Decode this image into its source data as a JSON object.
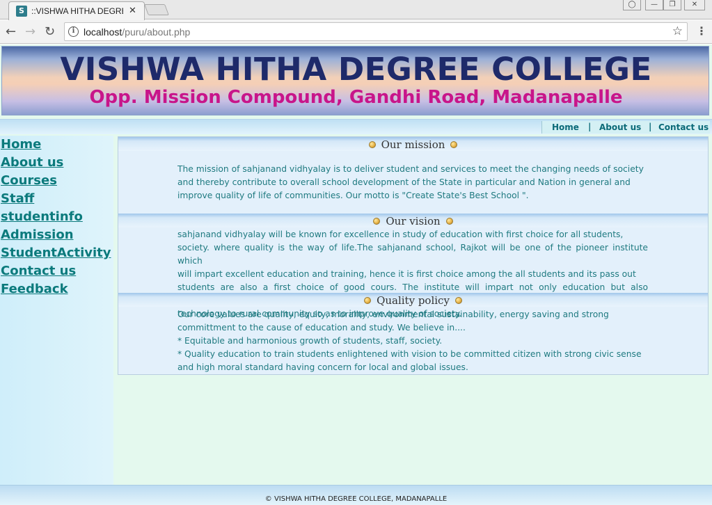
{
  "browser": {
    "tab_title": "::VISHWA HITHA DEGREE",
    "favicon_letter": "S",
    "close_glyph": "✕",
    "url_host": "localhost",
    "url_path": "/puru/about.php"
  },
  "banner": {
    "title": "VISHWA HITHA DEGREE COLLEGE",
    "subtitle": "Opp. Mission Compound, Gandhi Road, Madanapalle"
  },
  "topnav": {
    "items": [
      {
        "label": "Home"
      },
      {
        "label": "About us"
      },
      {
        "label": "Contact us"
      }
    ],
    "separator": "|"
  },
  "sidebar": {
    "items": [
      {
        "label": "Home"
      },
      {
        "label": "About us"
      },
      {
        "label": "Courses"
      },
      {
        "label": "Staff"
      },
      {
        "label": "studentinfo"
      },
      {
        "label": "Admission"
      },
      {
        "label": "StudentActivity"
      },
      {
        "label": "Contact us"
      },
      {
        "label": "Feedback"
      }
    ]
  },
  "sections": {
    "mission": {
      "title": "Our mission",
      "lines": [
        "The mission of sahjanand vidhyalay is to deliver student and services to meet the changing needs of society",
        "and thereby contribute to overall school development of the State in particular and Nation in general and",
        "improve quality of life of communities. Our motto is \"Create State's Best School \"."
      ]
    },
    "vision": {
      "title": "Our vision",
      "lines": [
        "sahjanand vidhyalay will be known for excellence in study of education with first choice for all students,",
        "society. where quality is the way of life.The sahjanand school, Rajkot will be one of the pioneer institute which",
        "will impart excellent education and training, hence it is first choice among the all students and its pass out",
        "students are also a first choice of good cours. The institute will impart not only education but also transferring",
        "technology to rural community so as to improve quality of society."
      ]
    },
    "quality": {
      "title": "Quality policy",
      "lines": [
        "Our core values are quality, equity, morality, environmental sustainability, energy saving and strong",
        "committment to the cause of education and study. We believe in....",
        "* Equitable and harmonious growth of students, staff, society.",
        "* Quality education to train students enlightened with vision to be committed citizen with strong civic sense",
        "and  high moral standard having concern for local and global issues."
      ]
    }
  },
  "footer": {
    "text": "© VISHWA HITHA DEGREE COLLEGE, MADANAPALLE"
  },
  "colors": {
    "link_teal": "#0b7a7c",
    "body_text": "#1f7a80",
    "page_bg": "#e4f9ee",
    "banner_title": "#1e2a6a",
    "banner_subtitle": "#c8158a"
  }
}
